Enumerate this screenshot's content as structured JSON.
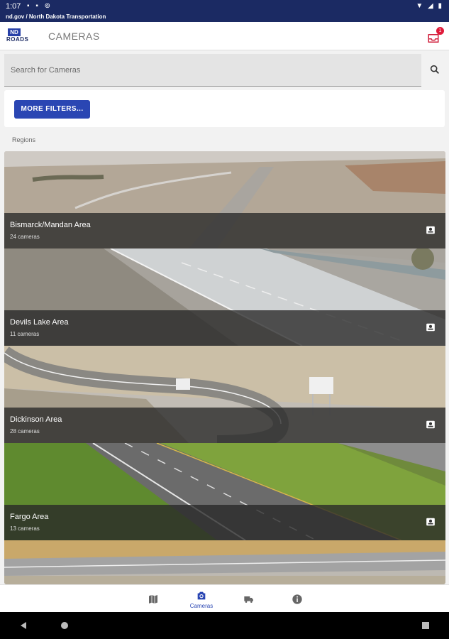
{
  "status_bar": {
    "time": "1:07",
    "url": "nd.gov / North Dakota Transportation"
  },
  "app_bar": {
    "logo_top": "ND",
    "logo_bottom": "ROADS",
    "title": "CAMERAS",
    "inbox_badge": "1"
  },
  "search": {
    "placeholder": "Search for Cameras"
  },
  "filters": {
    "more_filters_label": "MORE FILTERS..."
  },
  "regions_label": "Regions",
  "regions": [
    {
      "name": "Bismarck/Mandan Area",
      "count": "24 cameras"
    },
    {
      "name": "Devils Lake Area",
      "count": "11 cameras"
    },
    {
      "name": "Dickinson Area",
      "count": "28 cameras"
    },
    {
      "name": "Fargo Area",
      "count": "13 cameras"
    }
  ],
  "bottom_nav": {
    "cameras_label": "Cameras",
    "active": "Cameras"
  },
  "colors": {
    "primary": "#2a46b3",
    "status_bar": "#1b2a63",
    "badge": "#e01b3a"
  },
  "icons": [
    "map-icon",
    "camera-icon",
    "truck-icon",
    "info-icon",
    "search-icon",
    "inbox-icon",
    "camera-favorite-icon"
  ]
}
